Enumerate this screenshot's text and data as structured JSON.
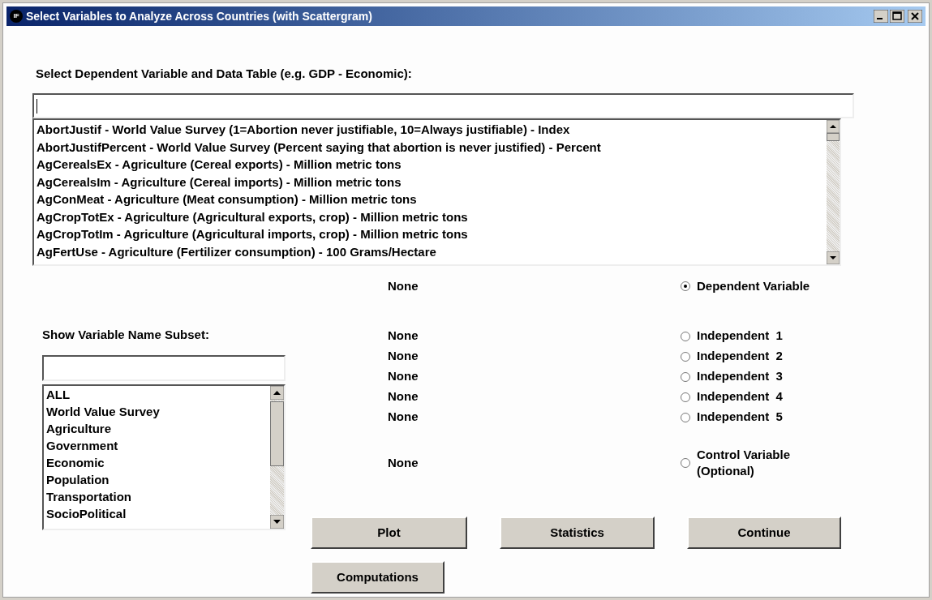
{
  "window": {
    "title": "Select Variables to Analyze Across Countries (with Scattergram)",
    "icon_text": "IF"
  },
  "dependent_label": "Select Dependent Variable and Data Table (e.g. GDP - Economic):",
  "variables": [
    "AbortJustif - World Value Survey (1=Abortion never justifiable, 10=Always justifiable) - Index",
    "AbortJustifPercent - World Value Survey (Percent saying that abortion is never justified) - Percent",
    "AgCerealsEx - Agriculture (Cereal exports) - Million metric tons",
    "AgCerealsIm - Agriculture (Cereal imports) - Million metric tons",
    "AgConMeat - Agriculture (Meat consumption) - Million metric tons",
    "AgCropTotEx - Agriculture (Agricultural exports, crop) - Million metric tons",
    "AgCropTotIm - Agriculture (Agricultural imports, crop) - Million metric tons",
    "AgFertUse - Agriculture (Fertilizer consumption) - 100 Grams/Hectare"
  ],
  "subset": {
    "label": "Show Variable Name Subset:",
    "items": [
      "ALL",
      "World Value Survey",
      "Agriculture",
      "Government",
      "Economic",
      "Population",
      "Transportation",
      "SocioPolitical"
    ]
  },
  "assignments": [
    {
      "kind": "dependent",
      "value": "None",
      "label": "Dependent Variable",
      "selected": true
    },
    {
      "kind": "independent",
      "value": "None",
      "label": "Independent  1",
      "selected": false
    },
    {
      "kind": "independent",
      "value": "None",
      "label": "Independent  2",
      "selected": false
    },
    {
      "kind": "independent",
      "value": "None",
      "label": "Independent  3",
      "selected": false
    },
    {
      "kind": "independent",
      "value": "None",
      "label": "Independent  4",
      "selected": false
    },
    {
      "kind": "independent",
      "value": "None",
      "label": "Independent  5",
      "selected": false
    },
    {
      "kind": "control",
      "value": "None",
      "label": "Control Variable (Optional)",
      "selected": false
    }
  ],
  "button_rows": [
    [
      "Plot",
      "Statistics",
      "Continue"
    ],
    [
      "Computations"
    ]
  ]
}
